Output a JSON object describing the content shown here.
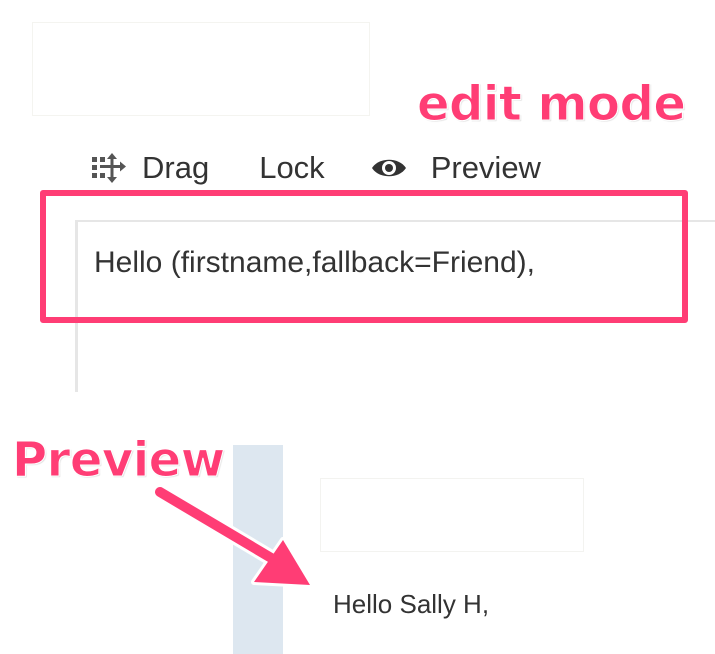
{
  "annotations": {
    "edit_mode": "edit mode",
    "preview": "Preview"
  },
  "toolbar": {
    "drag_label": "Drag",
    "lock_label": "Lock",
    "preview_label": "Preview"
  },
  "editor": {
    "content": "Hello (firstname,fallback=Friend),"
  },
  "preview_panel": {
    "content": "Hello Sally H,"
  },
  "colors": {
    "annotation": "#ff3d75",
    "text": "#333333",
    "column": "#dde7f0"
  },
  "icons": [
    "move-icon",
    "eye-icon",
    "arrow-icon"
  ]
}
